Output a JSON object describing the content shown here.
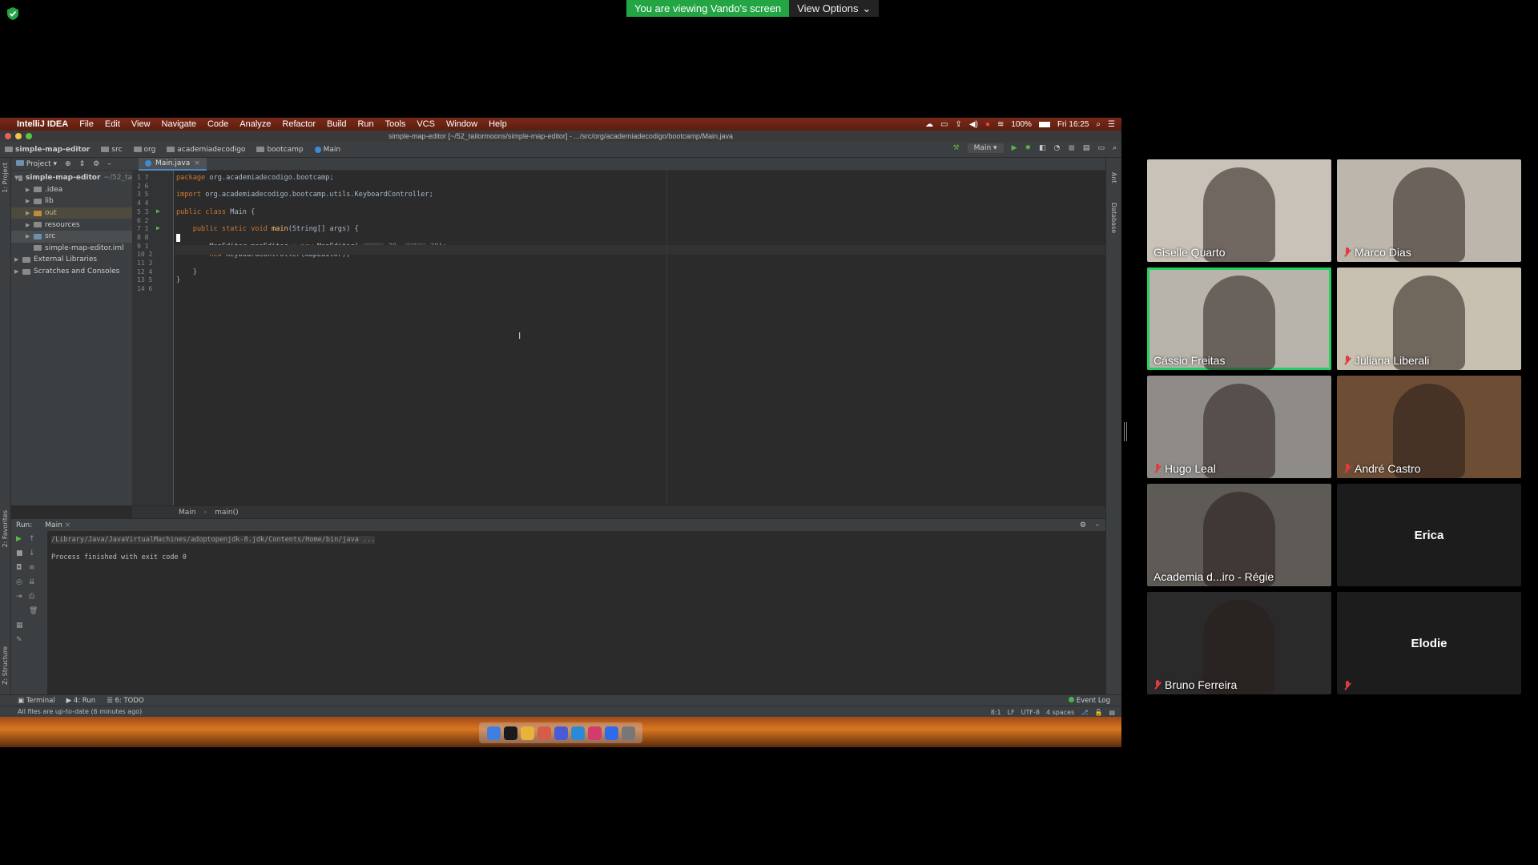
{
  "zoom": {
    "share_banner": "You are viewing Vando's screen",
    "view_options": "View Options",
    "participants": [
      {
        "name": "Giselle Quarto",
        "muted": false,
        "active": false,
        "bg": "#c9c2b8"
      },
      {
        "name": "Marco Dias",
        "muted": true,
        "active": false,
        "bg": "#bcb6ac"
      },
      {
        "name": "Cássio Freitas",
        "muted": false,
        "active": true,
        "bg": "#b8b3ab"
      },
      {
        "name": "Juliana Liberali",
        "muted": true,
        "active": false,
        "bg": "#c8c0b0"
      },
      {
        "name": "Hugo Leal",
        "muted": true,
        "active": false,
        "bg": "#8f8c88"
      },
      {
        "name": "André Castro",
        "muted": true,
        "active": false,
        "bg": "#6d4e35"
      },
      {
        "name": "Academia d...iro - Régie",
        "muted": false,
        "active": false,
        "bg": "#5e5a55"
      },
      {
        "name": "Erica",
        "muted": false,
        "active": false,
        "bg": "#1c1c1c",
        "video_off": true
      },
      {
        "name": "Bruno Ferreira",
        "muted": true,
        "active": false,
        "bg": "#2a2a2a"
      },
      {
        "name": "Elodie",
        "muted": true,
        "active": false,
        "bg": "#1c1c1c",
        "video_off": true
      }
    ]
  },
  "mac_menu": {
    "app": "IntelliJ IDEA",
    "items": [
      "File",
      "Edit",
      "View",
      "Navigate",
      "Code",
      "Analyze",
      "Refactor",
      "Build",
      "Run",
      "Tools",
      "VCS",
      "Window",
      "Help"
    ],
    "battery": "100%",
    "clock": "Fri 16:25"
  },
  "ide": {
    "window_title": "simple-map-editor [~/52_tailormoons/simple-map-editor] - .../src/org/academiadecodigo/bootcamp/Main.java",
    "breadcrumbs": [
      "simple-map-editor",
      "src",
      "org",
      "academiadecodigo",
      "bootcamp",
      "Main"
    ],
    "run_config": "Main",
    "project_label": "Project",
    "side_labels": {
      "project": "1: Project",
      "favorites": "2: Favorites",
      "structure": "Z: Structure",
      "ant": "Ant",
      "database": "Database"
    },
    "tree": [
      {
        "label": "simple-map-editor",
        "suffix": "~/52_ta",
        "depth": 0,
        "arrow": "▼",
        "bold": true
      },
      {
        "label": ".idea",
        "depth": 1,
        "arrow": "▶"
      },
      {
        "label": "lib",
        "depth": 1,
        "arrow": "▶"
      },
      {
        "label": "out",
        "depth": 1,
        "arrow": "▶",
        "style": "out"
      },
      {
        "label": "resources",
        "depth": 1,
        "arrow": "▶"
      },
      {
        "label": "src",
        "depth": 1,
        "arrow": "▶",
        "style": "sel"
      },
      {
        "label": "simple-map-editor.iml",
        "depth": 1,
        "arrow": ""
      },
      {
        "label": "External Libraries",
        "depth": 0,
        "arrow": "▶"
      },
      {
        "label": "Scratches and Consoles",
        "depth": 0,
        "arrow": "▶"
      }
    ],
    "tab": "Main.java",
    "line_numbers": [
      [
        "1",
        "7"
      ],
      [
        "2",
        "6"
      ],
      [
        "3",
        "5"
      ],
      [
        "4",
        "4"
      ],
      [
        "5",
        "3"
      ],
      [
        "6",
        "2"
      ],
      [
        "7",
        "1"
      ],
      [
        "8",
        "8"
      ],
      [
        "9",
        "1"
      ],
      [
        "10",
        "2"
      ],
      [
        "11",
        "3"
      ],
      [
        "12",
        "4"
      ],
      [
        "13",
        "5"
      ],
      [
        "14",
        "6"
      ]
    ],
    "code_lines": [
      [
        [
          "kw",
          "package "
        ],
        [
          "",
          "org.academiadecodigo.bootcamp;"
        ]
      ],
      [],
      [
        [
          "kw",
          "import "
        ],
        [
          "",
          "org.academiadecodigo.bootcamp.utils.KeyboardController;"
        ]
      ],
      [],
      [
        [
          "kw",
          "public class "
        ],
        [
          "",
          "Main {"
        ]
      ],
      [],
      [
        [
          "kw",
          "    public static void "
        ],
        [
          "fn",
          "main"
        ],
        [
          "",
          "(String[] args) {"
        ]
      ],
      [],
      [
        [
          "",
          "        MapEditor mapEditor = "
        ],
        [
          "kw",
          "new "
        ],
        [
          "",
          "MapEditor( "
        ],
        [
          "hint",
          "rows:"
        ],
        [
          "num",
          " 20"
        ],
        [
          "",
          ", "
        ],
        [
          "hint",
          "cols:"
        ],
        [
          "num",
          " 20"
        ],
        [
          "",
          ");"
        ]
      ],
      [
        [
          "kw",
          "        new "
        ],
        [
          "",
          "KeyboardController(mapEditor);"
        ]
      ],
      [],
      [
        [
          "",
          "    }"
        ]
      ],
      [
        [
          "",
          "}"
        ]
      ],
      []
    ],
    "bottom_crumbs": [
      "Main",
      "main()"
    ],
    "run_label": "Run:",
    "run_tab": "Main",
    "console_lines": [
      "/Library/Java/JavaVirtualMachines/adoptopenjdk-8.jdk/Contents/Home/bin/java ...",
      "",
      "Process finished with exit code 0"
    ],
    "bottom_tabs": [
      "Terminal",
      "4: Run",
      "6: TODO"
    ],
    "event_log": "Event Log",
    "status_left": "All files are up-to-date (6 minutes ago)",
    "status_right": [
      "8:1",
      "LF",
      "UTF-8",
      "4 spaces"
    ]
  },
  "dock_colors": [
    "#3f7fe0",
    "#1a1a1a",
    "#e8b33a",
    "#d65c4a",
    "#4a5bd8",
    "#2a8ad6",
    "#d23b6c",
    "#2d6be8",
    "#777777"
  ]
}
